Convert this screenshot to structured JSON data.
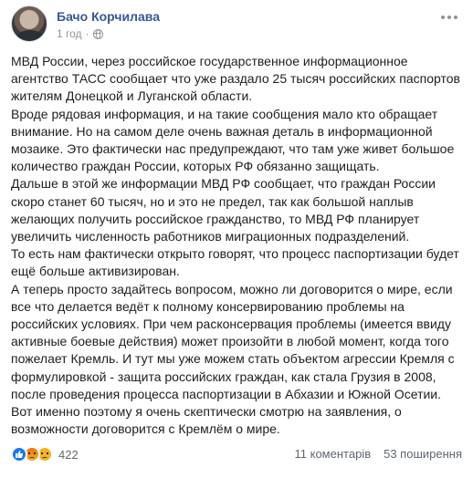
{
  "post": {
    "author": "Бачо Корчилава",
    "time": "1 год",
    "paragraphs": [
      "МВД России, через российское государственное информационное агентство ТАСС сообщает что уже раздало 25 тысяч российских паспортов жителям Донецкой и Луганской области.",
      "Вроде рядовая информация, и на такие сообщения мало кто обращает внимание. Но на самом деле очень важная деталь в информационной мозаике. Это фактически нас предупреждают, что там уже живет большое количество граждан России, которых РФ обязанно защищать.",
      "Дальше в этой же информации МВД РФ сообщает, что граждан России скоро станет 60 тысяч, но и это не предел, так как большой наплыв желающих получить российское гражданство, то МВД РФ планирует увеличить численность работников миграционных подразделений.",
      "То есть нам фактически открыто говорят, что процесс паспортизации будет ещё больше активизирован.",
      "А теперь просто задайтесь вопросом, можно ли договорится о мире, если все что делается ведёт к полному консервированию проблемы на российских условиях. При чем расконсервация проблемы (имеется ввиду активные боевые действия) может произойти в любой момент, когда того пожелает Кремль. И тут мы уже можем стать объектом агрессии Кремля с формулировкой - защита российских граждан, как стала Грузия в 2008, после проведения процесса паспортизации в Абхазии и Южной Осетии.",
      "Вот именно поэтому я очень скептически смотрю на заявления, о возможности договорится с Кремлём о мире."
    ],
    "reactions": {
      "icons": [
        "like-icon",
        "angry-icon",
        "sad-icon"
      ],
      "count": "422"
    },
    "comments": "11 коментарів",
    "shares": "53 поширення",
    "colors": {
      "author": "#385898",
      "like": "#1877f2",
      "meta": "#90949c"
    }
  }
}
